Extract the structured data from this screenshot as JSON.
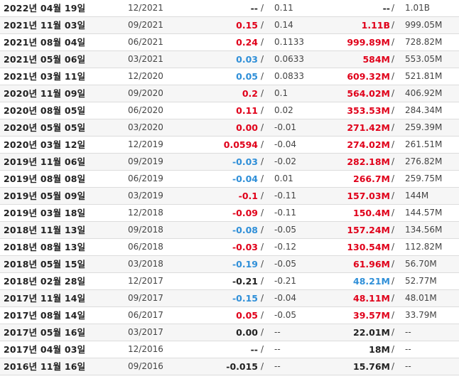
{
  "colors": {
    "red": "#e0001a",
    "blue": "#2f8fd8",
    "black": "#222222",
    "alt_row": "#f6f6f6"
  },
  "separator": "/",
  "rows": [
    {
      "date": "2022년 04월 19일",
      "period": "12/2021",
      "eps": "--",
      "eps_color": "black",
      "eps_est": "0.11",
      "rev": "--",
      "rev_color": "black",
      "rev_est": "1.01B"
    },
    {
      "date": "2021년 11월 03일",
      "period": "09/2021",
      "eps": "0.15",
      "eps_color": "red",
      "eps_est": "0.14",
      "rev": "1.11B",
      "rev_color": "red",
      "rev_est": "999.05M"
    },
    {
      "date": "2021년 08월 04일",
      "period": "06/2021",
      "eps": "0.24",
      "eps_color": "red",
      "eps_est": "0.1133",
      "rev": "999.89M",
      "rev_color": "red",
      "rev_est": "728.82M"
    },
    {
      "date": "2021년 05월 06일",
      "period": "03/2021",
      "eps": "0.03",
      "eps_color": "blue",
      "eps_est": "0.0633",
      "rev": "584M",
      "rev_color": "red",
      "rev_est": "553.05M"
    },
    {
      "date": "2021년 03월 11일",
      "period": "12/2020",
      "eps": "0.05",
      "eps_color": "blue",
      "eps_est": "0.0833",
      "rev": "609.32M",
      "rev_color": "red",
      "rev_est": "521.81M"
    },
    {
      "date": "2020년 11월 09일",
      "period": "09/2020",
      "eps": "0.2",
      "eps_color": "red",
      "eps_est": "0.1",
      "rev": "564.02M",
      "rev_color": "red",
      "rev_est": "406.92M"
    },
    {
      "date": "2020년 08월 05일",
      "period": "06/2020",
      "eps": "0.11",
      "eps_color": "red",
      "eps_est": "0.02",
      "rev": "353.53M",
      "rev_color": "red",
      "rev_est": "284.34M"
    },
    {
      "date": "2020년 05월 05일",
      "period": "03/2020",
      "eps": "0.00",
      "eps_color": "red",
      "eps_est": "-0.01",
      "rev": "271.42M",
      "rev_color": "red",
      "rev_est": "259.39M"
    },
    {
      "date": "2020년 03월 12일",
      "period": "12/2019",
      "eps": "0.0594",
      "eps_color": "red",
      "eps_est": "-0.04",
      "rev": "274.02M",
      "rev_color": "red",
      "rev_est": "261.51M"
    },
    {
      "date": "2019년 11월 06일",
      "period": "09/2019",
      "eps": "-0.03",
      "eps_color": "blue",
      "eps_est": "-0.02",
      "rev": "282.18M",
      "rev_color": "red",
      "rev_est": "276.82M"
    },
    {
      "date": "2019년 08월 08일",
      "period": "06/2019",
      "eps": "-0.04",
      "eps_color": "blue",
      "eps_est": "0.01",
      "rev": "266.7M",
      "rev_color": "red",
      "rev_est": "259.75M"
    },
    {
      "date": "2019년 05월 09일",
      "period": "03/2019",
      "eps": "-0.1",
      "eps_color": "red",
      "eps_est": "-0.11",
      "rev": "157.03M",
      "rev_color": "red",
      "rev_est": "144M"
    },
    {
      "date": "2019년 03월 18일",
      "period": "12/2018",
      "eps": "-0.09",
      "eps_color": "red",
      "eps_est": "-0.11",
      "rev": "150.4M",
      "rev_color": "red",
      "rev_est": "144.57M"
    },
    {
      "date": "2018년 11월 13일",
      "period": "09/2018",
      "eps": "-0.08",
      "eps_color": "blue",
      "eps_est": "-0.05",
      "rev": "157.24M",
      "rev_color": "red",
      "rev_est": "134.56M"
    },
    {
      "date": "2018년 08월 13일",
      "period": "06/2018",
      "eps": "-0.03",
      "eps_color": "red",
      "eps_est": "-0.12",
      "rev": "130.54M",
      "rev_color": "red",
      "rev_est": "112.82M"
    },
    {
      "date": "2018년 05월 15일",
      "period": "03/2018",
      "eps": "-0.19",
      "eps_color": "blue",
      "eps_est": "-0.05",
      "rev": "61.96M",
      "rev_color": "red",
      "rev_est": "56.70M"
    },
    {
      "date": "2018년 02월 28일",
      "period": "12/2017",
      "eps": "-0.21",
      "eps_color": "black",
      "eps_est": "-0.21",
      "rev": "48.21M",
      "rev_color": "blue",
      "rev_est": "52.77M"
    },
    {
      "date": "2017년 11월 14일",
      "period": "09/2017",
      "eps": "-0.15",
      "eps_color": "blue",
      "eps_est": "-0.04",
      "rev": "48.11M",
      "rev_color": "red",
      "rev_est": "48.01M"
    },
    {
      "date": "2017년 08월 14일",
      "period": "06/2017",
      "eps": "0.05",
      "eps_color": "red",
      "eps_est": "-0.05",
      "rev": "39.57M",
      "rev_color": "red",
      "rev_est": "33.79M"
    },
    {
      "date": "2017년 05월 16일",
      "period": "03/2017",
      "eps": "0.00",
      "eps_color": "black",
      "eps_est": "--",
      "rev": "22.01M",
      "rev_color": "black",
      "rev_est": "--"
    },
    {
      "date": "2017년 04월 03일",
      "period": "12/2016",
      "eps": "--",
      "eps_color": "black",
      "eps_est": "--",
      "rev": "18M",
      "rev_color": "black",
      "rev_est": "--"
    },
    {
      "date": "2016년 11월 16일",
      "period": "09/2016",
      "eps": "-0.015",
      "eps_color": "black",
      "eps_est": "--",
      "rev": "15.76M",
      "rev_color": "black",
      "rev_est": "--"
    }
  ]
}
